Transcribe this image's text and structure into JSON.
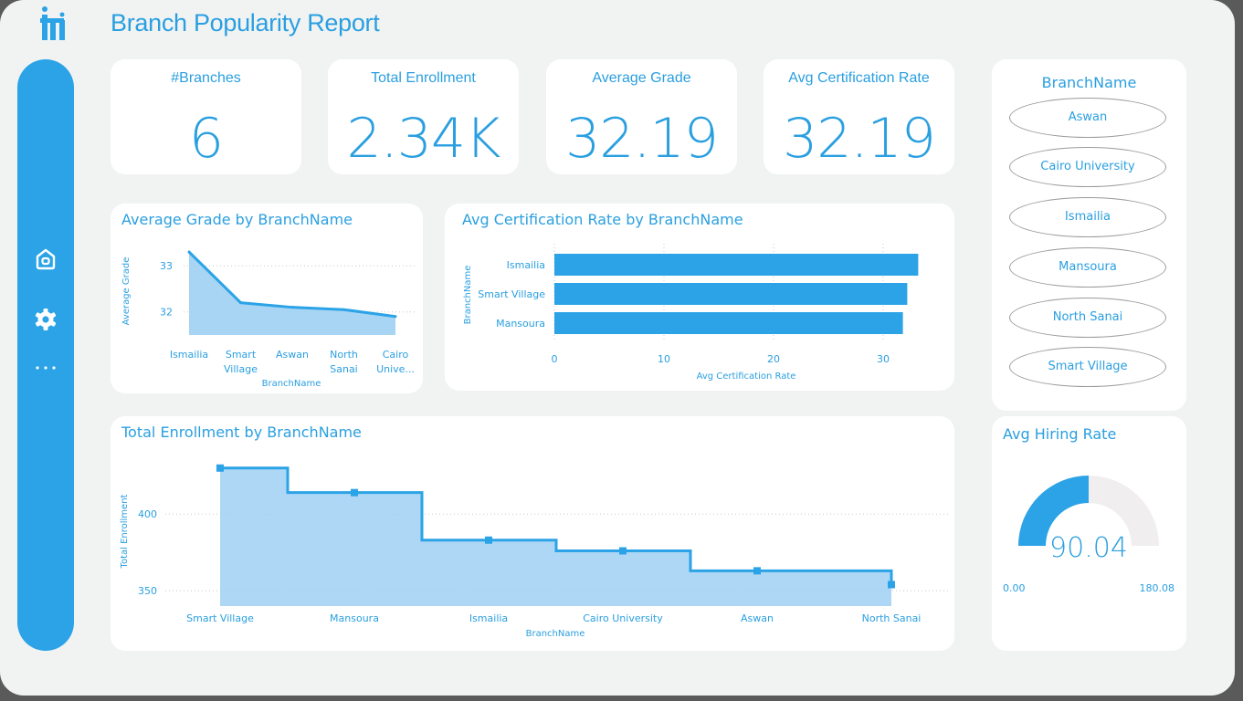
{
  "header": {
    "title": "Branch Popularity Report"
  },
  "sidebar": {
    "items": [
      {
        "icon": "home-icon"
      },
      {
        "icon": "gear-icon"
      },
      {
        "icon": "more-icon"
      }
    ]
  },
  "kpis": [
    {
      "label": "#Branches",
      "value": "6"
    },
    {
      "label": "Total Enrollment",
      "value": "2.34K"
    },
    {
      "label": "Average Grade",
      "value": "32.19"
    },
    {
      "label": "Avg Certification Rate",
      "value": "32.19"
    }
  ],
  "slicer": {
    "title": "BranchName",
    "options": [
      "Aswan",
      "Cairo University",
      "Ismailia",
      "Mansoura",
      "North Sanai",
      "Smart Village"
    ]
  },
  "gauge": {
    "title": "Avg Hiring Rate",
    "value": 90.04,
    "value_label": "90.04",
    "min_label": "0.00",
    "max_label": "180.08"
  },
  "colors": {
    "accent": "#2ba3e6",
    "area": "#9fd0f3",
    "text": "#2a9fe0"
  },
  "chart_data": [
    {
      "type": "area",
      "title": "Average Grade by BranchName",
      "xlabel": "BranchName",
      "ylabel": "Average Grade",
      "categories": [
        "Ismailia",
        "Smart Village",
        "Aswan",
        "North Sanai",
        "Cairo Unive..."
      ],
      "category_lines": [
        [
          "Ismailia"
        ],
        [
          "Smart",
          "Village"
        ],
        [
          "Aswan"
        ],
        [
          "North",
          "Sanai"
        ],
        [
          "Cairo",
          "Unive..."
        ]
      ],
      "values": [
        33.3,
        32.2,
        32.1,
        32.05,
        31.9
      ],
      "yticks": [
        32,
        33
      ],
      "ylim": [
        31.5,
        33.4
      ],
      "grid": true
    },
    {
      "type": "bar",
      "title": "Avg Certification Rate by BranchName",
      "xlabel": "Avg Certification Rate",
      "ylabel": "BranchName",
      "categories": [
        "Ismailia",
        "Smart Village",
        "Mansoura"
      ],
      "values": [
        33.2,
        32.2,
        31.8
      ],
      "xticks": [
        0,
        10,
        20,
        30
      ],
      "xlim": [
        0,
        34
      ],
      "grid": true
    },
    {
      "type": "area",
      "title": "Total Enrollment by BranchName",
      "xlabel": "BranchName",
      "ylabel": "Total Enrollment",
      "categories": [
        "Smart Village",
        "Mansoura",
        "Ismailia",
        "Cairo University",
        "Aswan",
        "North Sanai"
      ],
      "values": [
        430,
        414,
        383,
        376,
        363,
        354
      ],
      "yticks": [
        350,
        400
      ],
      "ylim": [
        340,
        440
      ],
      "grid": true
    }
  ]
}
